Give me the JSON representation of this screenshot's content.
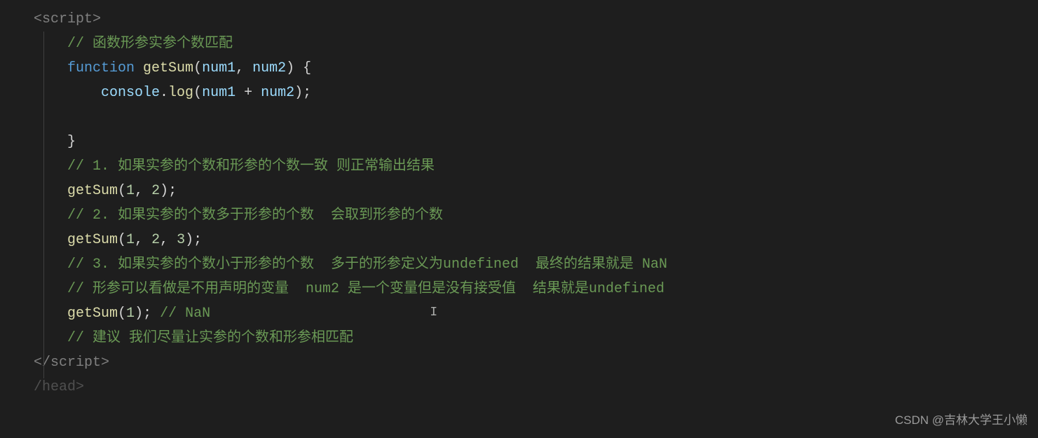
{
  "code": {
    "scriptOpen": "<script>",
    "scriptClose": "</script>",
    "comment1": "// 函数形参实参个数匹配",
    "functionKw": "function",
    "funcName": "getSum",
    "param1": "num1",
    "param2": "num2",
    "consoleObj": "console",
    "logMethod": "log",
    "plusOp": " + ",
    "comment2": "// 1. 如果实参的个数和形参的个数一致 则正常输出结果",
    "call1_fn": "getSum",
    "call1_arg1": "1",
    "call1_arg2": "2",
    "comment3": "// 2. 如果实参的个数多于形参的个数  会取到形参的个数",
    "call2_fn": "getSum",
    "call2_arg1": "1",
    "call2_arg2": "2",
    "call2_arg3": "3",
    "comment4": "// 3. 如果实参的个数小于形参的个数  多于的形参定义为undefined  最终的结果就是 NaN",
    "comment5": "// 形参可以看做是不用声明的变量  num2 是一个变量但是没有接受值  结果就是undefined",
    "call3_fn": "getSum",
    "call3_arg1": "1",
    "comment6": "// NaN",
    "comment7": "// 建议 我们尽量让实参的个数和形参相匹配",
    "headClose": "/head>"
  },
  "watermark": "CSDN @吉林大学王小懒"
}
